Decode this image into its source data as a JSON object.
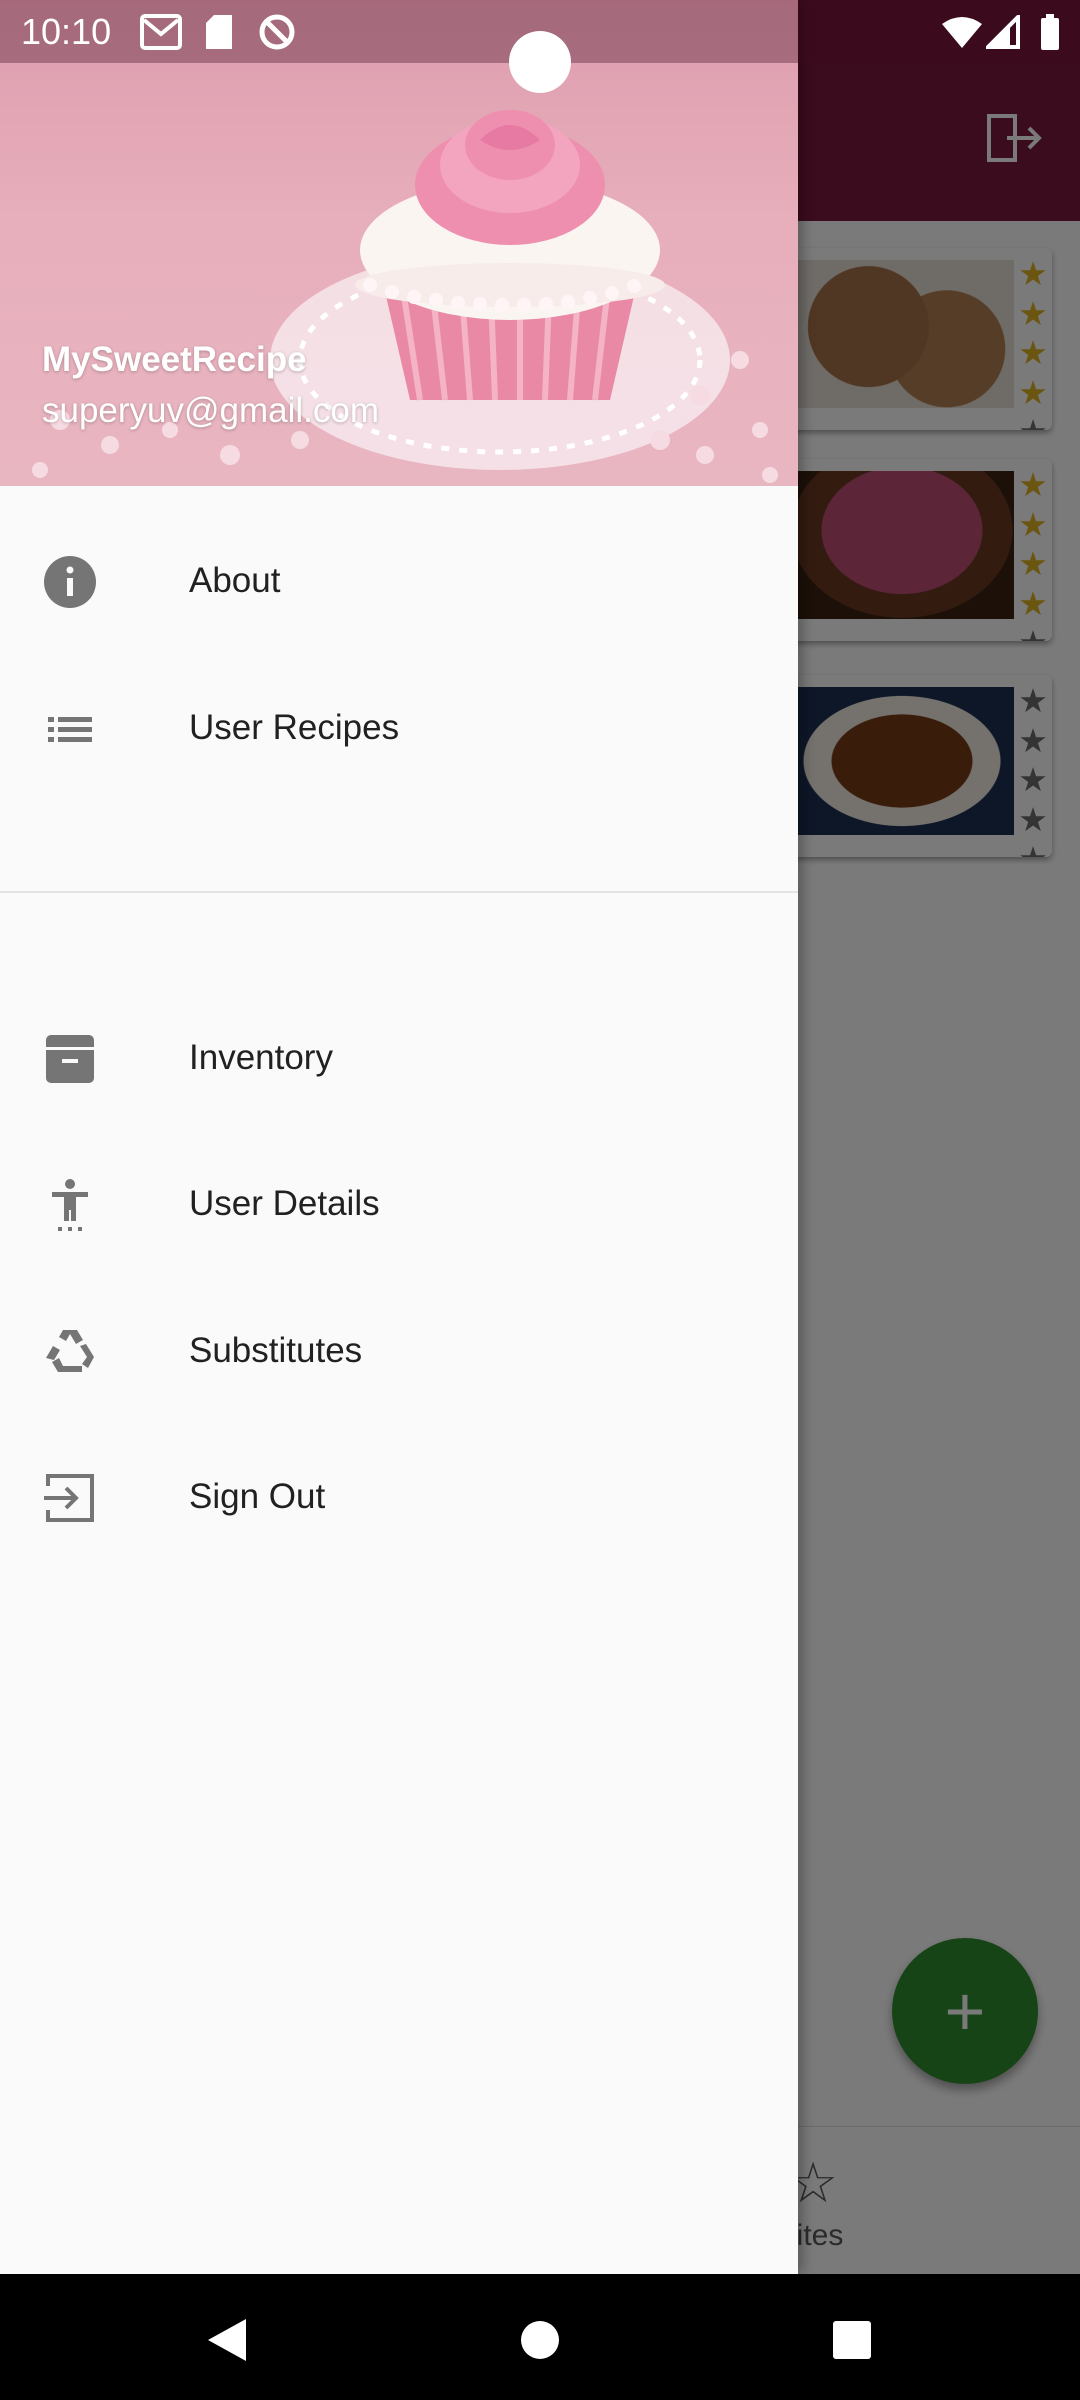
{
  "status_bar": {
    "time": "10:10",
    "icons": [
      "gmail-icon",
      "sd-card-icon",
      "do-not-disturb-icon",
      "wifi-icon",
      "signal-icon",
      "battery-icon"
    ]
  },
  "drawer": {
    "header": {
      "app_name": "MySweetRecipe",
      "email": "superyuv@gmail.com"
    },
    "primary_items": [
      {
        "label": "About",
        "icon": "info-icon"
      },
      {
        "label": "User Recipes",
        "icon": "list-icon"
      }
    ],
    "secondary_items": [
      {
        "label": "Inventory",
        "icon": "archive-icon"
      },
      {
        "label": "User Details",
        "icon": "accessibility-icon"
      },
      {
        "label": "Substitutes",
        "icon": "recycle-icon"
      },
      {
        "label": "Sign Out",
        "icon": "exit-icon"
      }
    ]
  },
  "background_app": {
    "appbar_icon": "exit-icon",
    "recipe_cards": [
      {
        "rating": 4,
        "max_rating": 5
      },
      {
        "rating": 4,
        "max_rating": 5
      },
      {
        "rating": 0,
        "max_rating": 5
      }
    ],
    "fab_icon": "plus-icon",
    "bottom_nav_partial_label": "orites"
  },
  "colors": {
    "appbar": "#7b1a3f",
    "drawer_background": "#fafafa",
    "fab": "#2f8f2f",
    "star_filled": "#e0b324",
    "star_empty": "#6d6d6d"
  },
  "system_nav": [
    "back-button",
    "home-button",
    "recents-button"
  ]
}
